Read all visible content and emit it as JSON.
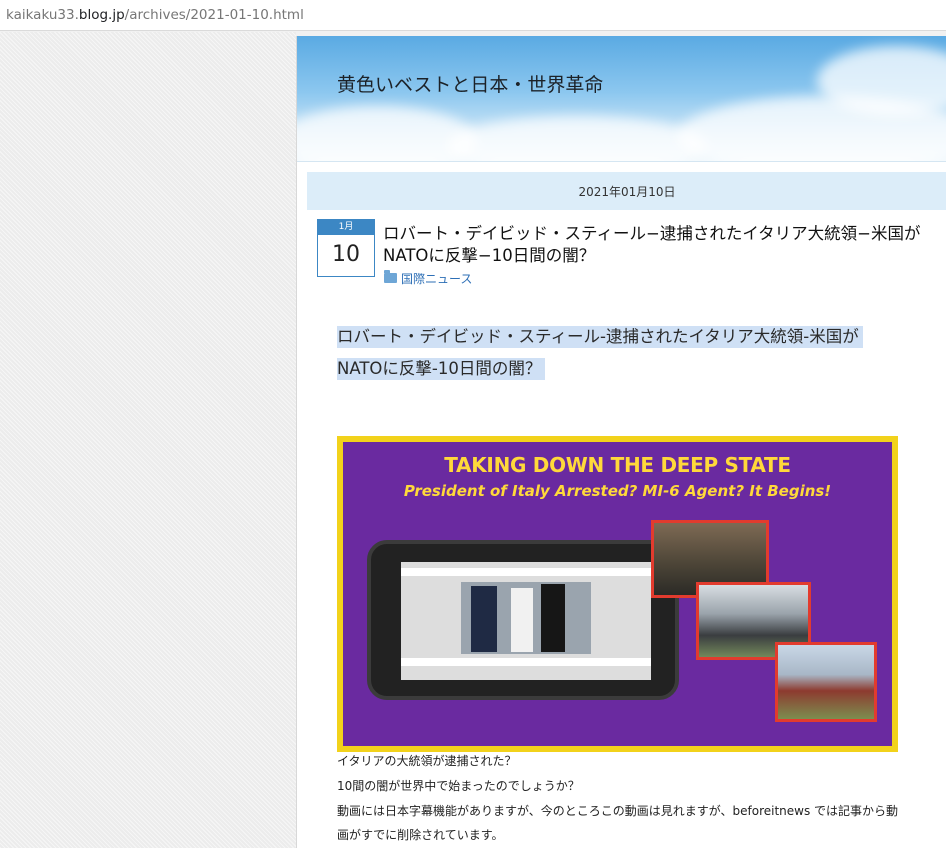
{
  "browser": {
    "url_prefix": "kaikaku33.",
    "url_host": "blog.jp",
    "url_path": "/archives/2021-01-10.html"
  },
  "blog": {
    "title": "黄色いベストと日本・世界革命"
  },
  "date_header": "2021年01月10日",
  "post": {
    "calendar_month": "1月",
    "calendar_day": "10",
    "title": "ロバート・デイビッド・スティール−逮捕されたイタリア大統領−米国がNATOに反撃−10日間の闇？",
    "category": "国際ニュース",
    "body_title_line1": "ロバート・デイビッド・スティール-逮捕されたイタリア大統領-米国が",
    "body_title_line2": "NATOに反撃-10日間の闇？",
    "thumbnail": {
      "headline": "TAKING DOWN THE DEEP STATE",
      "subheadline": "President of Italy Arrested? MI-6 Agent? It Begins!"
    },
    "paragraphs": [
      "イタリアの大統領が逮捕された？",
      "10間の闇が世界中で始まったのでしょうか？",
      " 動画には日本字幕機能がありますが、今のところこの動画は見れますが、beforeitnews では記事から動",
      "画がすでに削除されています。"
    ]
  },
  "colors": {
    "accent": "#3c87c4",
    "date_bar": "#dcedf9",
    "thumb_border": "#f2d21b",
    "thumb_bg": "#6a2aa0",
    "thumb_text": "#ffd93a"
  }
}
